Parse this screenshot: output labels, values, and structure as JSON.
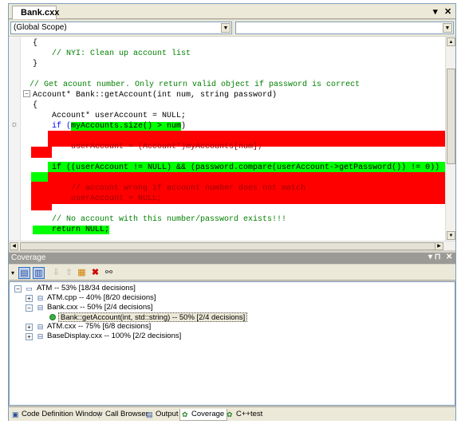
{
  "document_tab": {
    "label": "Bank.cxx",
    "dropdown_glyph": "▾",
    "close_glyph": "✕"
  },
  "scope": {
    "left_value": "(Global Scope)",
    "right_value": ""
  },
  "code": {
    "lines": [
      "{",
      "    // NYI: Clean up account list",
      "}",
      "",
      "// Get acount number. Only return valid object if password is correct",
      "Account* Bank::getAccount(int num, string password)",
      "{",
      "    Account* userAccount = NULL;",
      "    if (myAccounts.size() > num)",
      "",
      "        userAccount = (Account*)myAccounts[num];",
      "",
      "    if ((userAccount != NULL) && (password.compare(userAccount->getPassword()) != 0))",
      "",
      "        // account wrong if account number does not match",
      "        userAccount = NULL;",
      "",
      "    // No account with this number/password exists!!!",
      "    return NULL;"
    ],
    "if_prefix": "    if (",
    "if_condition": "myAccounts.size() > num",
    "if_close": ")"
  },
  "coverage_panel": {
    "title": "Coverage",
    "pin_glyph": "▾ ⊓",
    "close_glyph": "✕",
    "tree": [
      {
        "label": "ATM -- 53% [18/34 decisions]"
      },
      {
        "label": "ATM.cpp -- 40% [8/20 decisions]"
      },
      {
        "label": "Bank.cxx -- 50% [2/4 decisions]"
      },
      {
        "label": "Bank::getAccount(int, std::string) -- 50% [2/4 decisions]"
      },
      {
        "label": "ATM.cxx -- 75% [6/8 decisions]"
      },
      {
        "label": "BaseDisplay.cxx -- 100% [2/2 decisions]"
      }
    ]
  },
  "bottom_tabs": [
    {
      "label": "Code Definition Window"
    },
    {
      "label": "Call Browser"
    },
    {
      "label": "Output"
    },
    {
      "label": "Coverage"
    },
    {
      "label": "C++test"
    }
  ],
  "colors": {
    "covered": "#00ff00",
    "uncovered": "#ff0000",
    "comment": "#008000",
    "keyword": "#0000ff"
  },
  "icons": [
    "dropdown-icon",
    "close-icon",
    "bug-icon",
    "folder-icon",
    "file-icon",
    "green-dot-icon",
    "binoculars-icon",
    "delete-icon"
  ]
}
